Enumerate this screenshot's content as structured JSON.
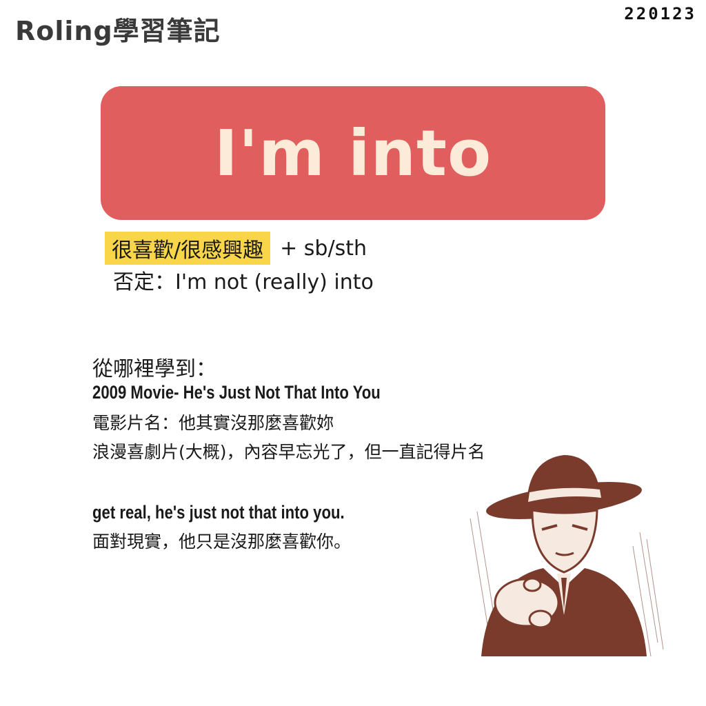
{
  "header": {
    "brand": "Roling學習筆記",
    "date_code": "220123"
  },
  "title": {
    "phrase": "I'm into"
  },
  "definition": {
    "meaning": "很喜歡/很感興趣",
    "usage": "+ sb/sth",
    "negative": "否定：I'm not (really) into"
  },
  "source": {
    "heading": "從哪裡學到：",
    "movie": "2009 Movie- He's Just Not That Into You",
    "movie_cn_title": "電影片名：他其實沒那麼喜歡妳",
    "note": "浪漫喜劇片(大概)，內容早忘光了，但一直記得片名"
  },
  "quote": {
    "english": "get real, he's just not that into you.",
    "chinese": "面對現實，他只是沒那麼喜歡你。"
  },
  "colors": {
    "title_bg": "#e05e5d",
    "title_text": "#fcebd8",
    "highlight": "#f9d649",
    "illustration": "#7a3b2c"
  }
}
